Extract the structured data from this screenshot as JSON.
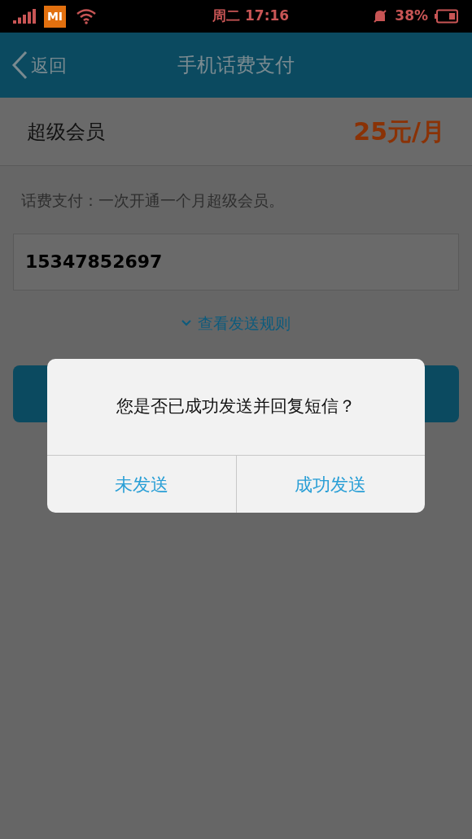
{
  "status_bar": {
    "carrier_logo": "MI",
    "time": "周二 17:16",
    "battery": "38%"
  },
  "nav": {
    "back": "返回",
    "title": "手机话费支付"
  },
  "plan": {
    "name": "超级会员",
    "price": "25元/月"
  },
  "description": "话费支付：一次开通一个月超级会员。",
  "phone_field": {
    "value": "15347852697"
  },
  "rules_link": "查看发送规则",
  "dialog": {
    "message": "您是否已成功发送并回复短信？",
    "buttons": [
      "未发送",
      "成功发送"
    ]
  }
}
